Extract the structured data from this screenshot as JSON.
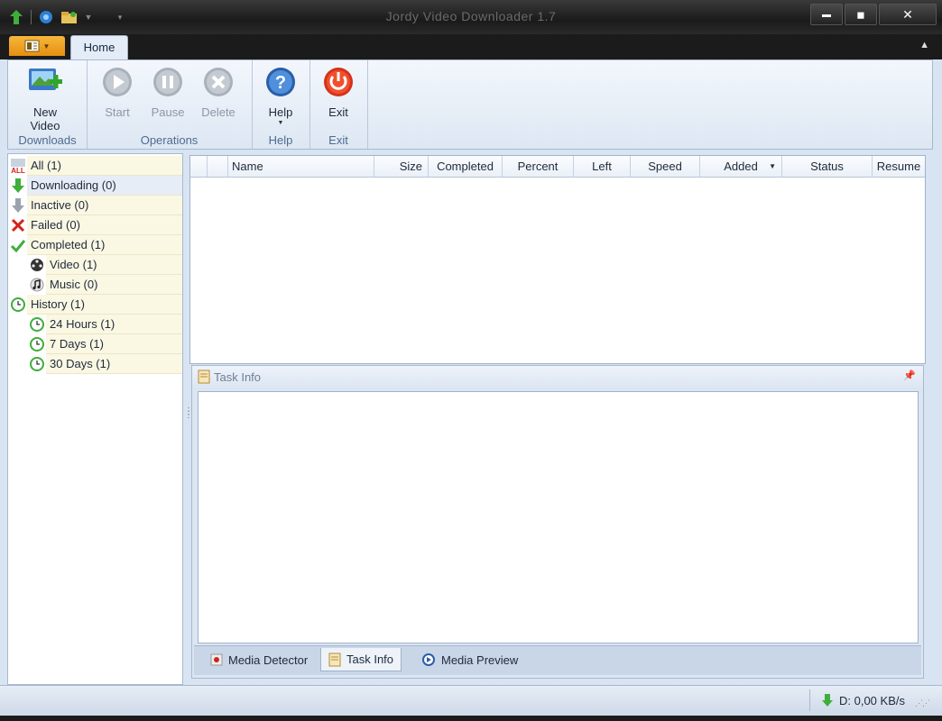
{
  "window": {
    "title": "Jordy Video Downloader 1.7"
  },
  "titlebar": {
    "minimize": "▬",
    "maximize": "◼",
    "close": "✕"
  },
  "ribbon": {
    "tab_home": "Home",
    "groups": {
      "downloads": {
        "label": "Downloads",
        "new_video": "New Video"
      },
      "operations": {
        "label": "Operations",
        "start": "Start",
        "pause": "Pause",
        "delete": "Delete"
      },
      "help": {
        "label": "Help",
        "help": "Help"
      },
      "exit": {
        "label": "Exit",
        "exit": "Exit"
      }
    }
  },
  "nav": {
    "all": "All (1)",
    "downloading": "Downloading (0)",
    "inactive": "Inactive (0)",
    "failed": "Failed (0)",
    "completed": "Completed (1)",
    "video": "Video (1)",
    "music": "Music (0)",
    "history": "History (1)",
    "h24": "24 Hours (1)",
    "d7": "7 Days (1)",
    "d30": "30 Days (1)"
  },
  "grid": {
    "columns": [
      "Name",
      "Size",
      "Completed",
      "Percent",
      "Left",
      "Speed",
      "Added",
      "Status",
      "Resume"
    ]
  },
  "taskinfo": {
    "title": "Task Info",
    "tabs": [
      "Media Detector",
      "Task Info",
      "Media Preview"
    ]
  },
  "status": {
    "speed": "D: 0,00 KB/s"
  },
  "colors": {
    "app_button": "#f0a428",
    "frame": "#1b1b1b",
    "nav_item_bg": "#faf7e3",
    "exit_red": "#e23b1b"
  }
}
